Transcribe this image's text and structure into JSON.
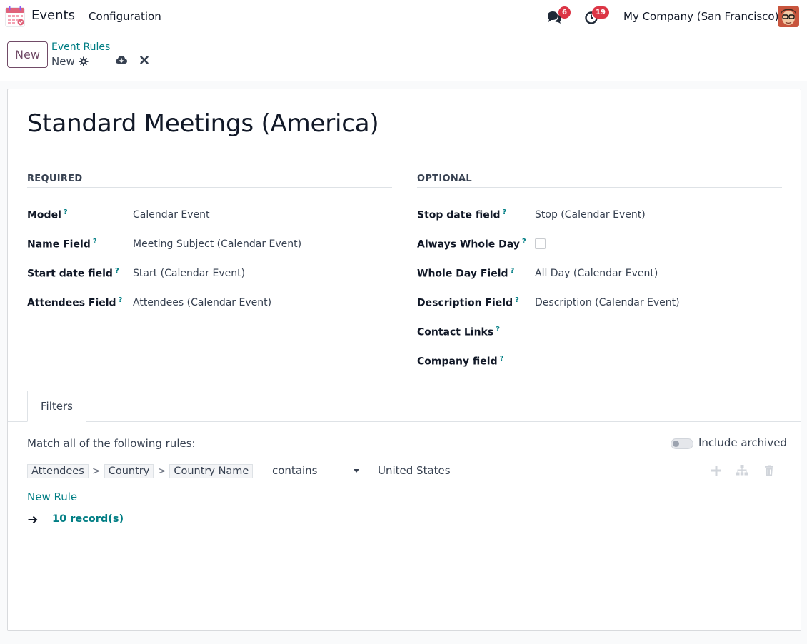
{
  "navbar": {
    "app_name": "Events",
    "menu": [
      "Configuration"
    ],
    "chat_count": "6",
    "activity_count": "19",
    "company": "My Company (San Francisco)"
  },
  "control_panel": {
    "new_label": "New",
    "breadcrumb_parent": "Event Rules",
    "breadcrumb_current": "New"
  },
  "form": {
    "title": "Standard Meetings (America)",
    "required": {
      "heading": "REQUIRED",
      "fields": [
        {
          "label": "Model",
          "value": "Calendar Event"
        },
        {
          "label": "Name Field",
          "value": "Meeting Subject (Calendar Event)"
        },
        {
          "label": "Start date field",
          "value": "Start (Calendar Event)"
        },
        {
          "label": "Attendees Field",
          "value": "Attendees (Calendar Event)"
        }
      ]
    },
    "optional": {
      "heading": "OPTIONAL",
      "fields": [
        {
          "label": "Stop date field",
          "value": "Stop (Calendar Event)"
        },
        {
          "label": "Always Whole Day",
          "value": ""
        },
        {
          "label": "Whole Day Field",
          "value": "All Day (Calendar Event)"
        },
        {
          "label": "Description Field",
          "value": "Description (Calendar Event)"
        },
        {
          "label": "Contact Links",
          "value": ""
        },
        {
          "label": "Company field",
          "value": ""
        }
      ],
      "always_whole_day_checked": false
    },
    "tooltip_marker": "?"
  },
  "filters": {
    "tab_label": "Filters",
    "match_text": "Match all of the following rules:",
    "include_archived_label": "Include archived",
    "include_archived": false,
    "rule": {
      "path": [
        "Attendees",
        "Country",
        "Country Name"
      ],
      "path_separator": ">",
      "operator": "contains",
      "value": "United States"
    },
    "new_rule_label": "New Rule",
    "records_label": "10 record(s)"
  },
  "colors": {
    "accent": "#017e84",
    "brand": "#714b67",
    "badge": "#dc3545"
  }
}
